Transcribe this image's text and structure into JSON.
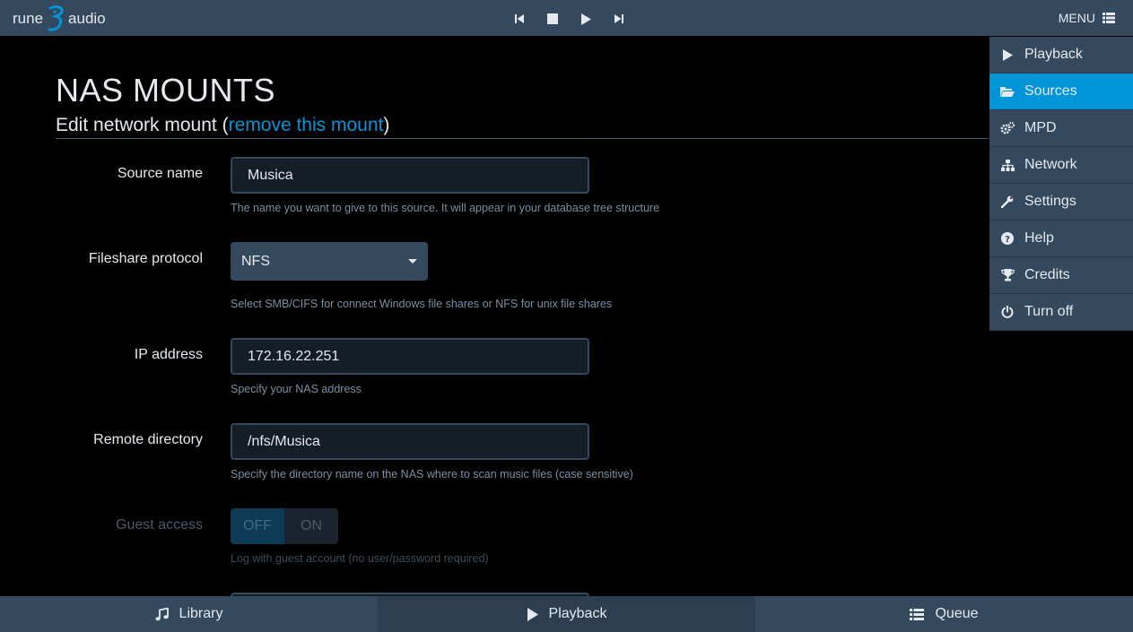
{
  "app": {
    "logo_left": "rune",
    "logo_right": "audio"
  },
  "header": {
    "menu_label": "MENU"
  },
  "transport": {
    "icons": [
      "previous-icon",
      "stop-icon",
      "play-icon",
      "next-icon"
    ]
  },
  "page": {
    "title": "NAS MOUNTS",
    "subtitle_prefix": "Edit network mount (",
    "subtitle_link": "remove this mount",
    "subtitle_suffix": ")"
  },
  "form": {
    "source_name": {
      "label": "Source name",
      "value": "Musica",
      "help": "The name you want to give to this source. It will appear in your database tree structure"
    },
    "protocol": {
      "label": "Fileshare protocol",
      "value": "NFS",
      "help": "Select SMB/CIFS for connect Windows file shares or NFS for unix file shares"
    },
    "ip_address": {
      "label": "IP address",
      "value": "172.16.22.251",
      "help": "Specify your NAS address"
    },
    "remote_dir": {
      "label": "Remote directory",
      "value": "/nfs/Musica",
      "help": "Specify the directory name on the NAS where to scan music files (case sensitive)"
    },
    "guest_access": {
      "label": "Guest access",
      "off": "OFF",
      "on": "ON",
      "help": "Log with guest account (no user/password required)"
    }
  },
  "menu": {
    "items": [
      {
        "label": "Playback",
        "icon": "play-icon"
      },
      {
        "label": "Sources",
        "icon": "folder-open-icon",
        "active": true
      },
      {
        "label": "MPD",
        "icon": "cogs-icon"
      },
      {
        "label": "Network",
        "icon": "sitemap-icon"
      },
      {
        "label": "Settings",
        "icon": "wrench-icon"
      },
      {
        "label": "Help",
        "icon": "question-circle-icon"
      },
      {
        "label": "Credits",
        "icon": "trophy-icon"
      },
      {
        "label": "Turn off",
        "icon": "power-icon"
      }
    ]
  },
  "bottom_tabs": [
    {
      "label": "Library",
      "icon": "music-icon"
    },
    {
      "label": "Playback",
      "icon": "play-icon",
      "active": true
    },
    {
      "label": "Queue",
      "icon": "list-icon"
    }
  ],
  "colors": {
    "bar": "#34495e",
    "accent": "#0095d8",
    "background": "#000000",
    "muted": "#7a8fa3"
  }
}
